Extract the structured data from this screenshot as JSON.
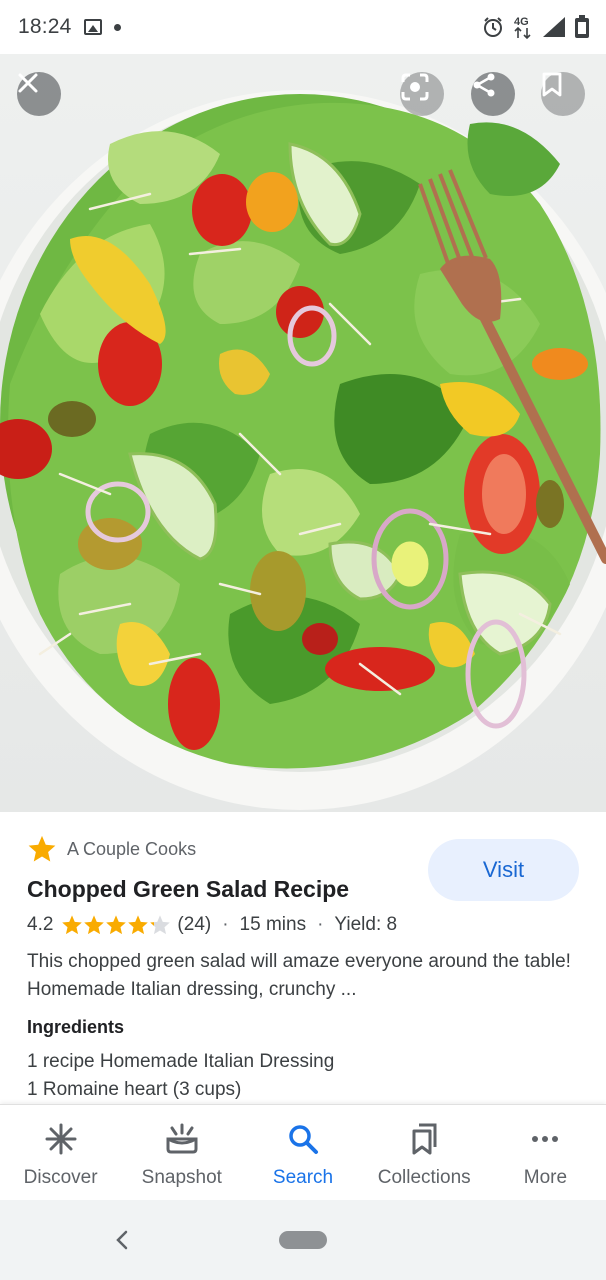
{
  "status_bar": {
    "time": "18:24",
    "network": "4G",
    "icons": [
      "image-icon",
      "notification-dot-icon",
      "alarm-icon",
      "network-4g-icon",
      "signal-icon",
      "battery-icon"
    ]
  },
  "hero": {
    "image_alt": "Chopped green salad in a white bowl",
    "buttons": [
      "close-icon",
      "lens-icon",
      "share-icon",
      "bookmark-icon"
    ]
  },
  "result": {
    "source": "A Couple Cooks",
    "visit_label": "Visit",
    "title": "Chopped Green Salad Recipe",
    "rating": "4.2",
    "rating_value": 4.2,
    "rating_max": 5,
    "review_count": "(24)",
    "time": "15 mins",
    "yield": "Yield: 8",
    "separator": "·",
    "snippet": "This chopped green salad will amaze everyone around the table! Homemade Italian dressing, crunchy ...",
    "ingredients_heading": "Ingredients",
    "ingredients": [
      "1 recipe Homemade Italian Dressing",
      "1 Romaine heart (3 cups)"
    ]
  },
  "bottom_nav": {
    "items": [
      {
        "label": "Discover",
        "icon": "discover-icon"
      },
      {
        "label": "Snapshot",
        "icon": "snapshot-icon"
      },
      {
        "label": "Search",
        "icon": "search-icon",
        "active": true
      },
      {
        "label": "Collections",
        "icon": "collections-icon"
      },
      {
        "label": "More",
        "icon": "more-icon"
      }
    ]
  },
  "colors": {
    "accent": "#1a73e8",
    "visit_bg": "#e8f0fe",
    "star": "#f9ab00",
    "star_empty": "#dadce0",
    "lettuce": "#5cae3a",
    "tomato": "#d8261c"
  }
}
